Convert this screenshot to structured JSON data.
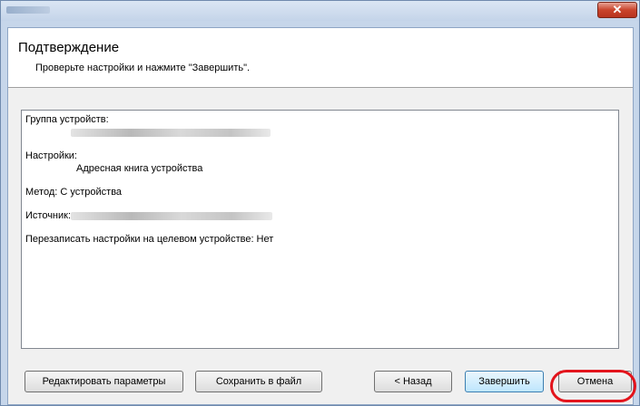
{
  "window": {
    "close_glyph": "✕"
  },
  "header": {
    "title": "Подтверждение",
    "subtitle": "Проверьте настройки и нажмите \"Завершить\"."
  },
  "summary": {
    "device_group_label": "Группа устройств:",
    "settings_label": "Настройки:",
    "settings_value": "Адресная книга устройства",
    "method_line": "Метод: С устройства",
    "source_label": "Источник:",
    "overwrite_line": "Перезаписать настройки на целевом устройстве: Нет"
  },
  "buttons": {
    "edit": "Редактировать параметры",
    "save_to_file": "Сохранить в файл",
    "back": "< Назад",
    "finish": "Завершить",
    "cancel": "Отмена"
  },
  "colors": {
    "highlight": "#e3141c"
  }
}
